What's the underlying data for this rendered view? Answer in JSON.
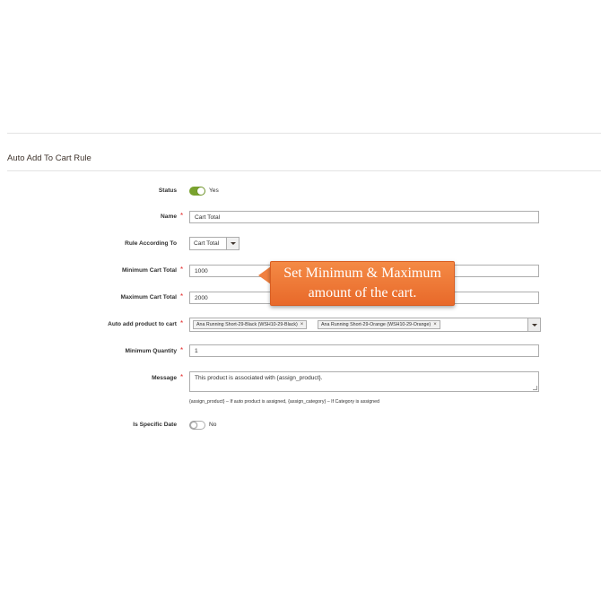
{
  "section": {
    "title": "Auto Add To Cart Rule"
  },
  "form": {
    "status": {
      "label": "Status",
      "value_text": "Yes",
      "enabled": true
    },
    "name": {
      "label": "Name",
      "value": "Cart Total"
    },
    "rule_according_to": {
      "label": "Rule According To",
      "selected": "Cart Total"
    },
    "minimum_cart_total": {
      "label": "Minimum Cart Total",
      "value": "1000"
    },
    "maximum_cart_total": {
      "label": "Maximum Cart Total",
      "value": "2000"
    },
    "auto_add_product": {
      "label": "Auto add product to cart",
      "chips": [
        {
          "label": "Ana Running Short-29-Black (WSH10-29-Black)",
          "remove": "×"
        },
        {
          "label": "Ana Running Short-29-Orange (WSH10-29-Orange)",
          "remove": "×"
        }
      ]
    },
    "minimum_quantity": {
      "label": "Minimum Quantity",
      "value": "1"
    },
    "message": {
      "label": "Message",
      "value": "This product is associated with {assign_product}.",
      "note": "{assign_product} – If auto product is assigned, {assign_category} – If Category is assigned"
    },
    "is_specific_date": {
      "label": "Is Specific Date",
      "value_text": "No",
      "enabled": false
    },
    "required_marker": "*"
  },
  "callout": {
    "line1": "Set Minimum & Maximum",
    "line2": "amount of the cart.",
    "color": "#f07a35"
  },
  "colors": {
    "toggle_on": "#79a22e",
    "required": "#e22626"
  }
}
